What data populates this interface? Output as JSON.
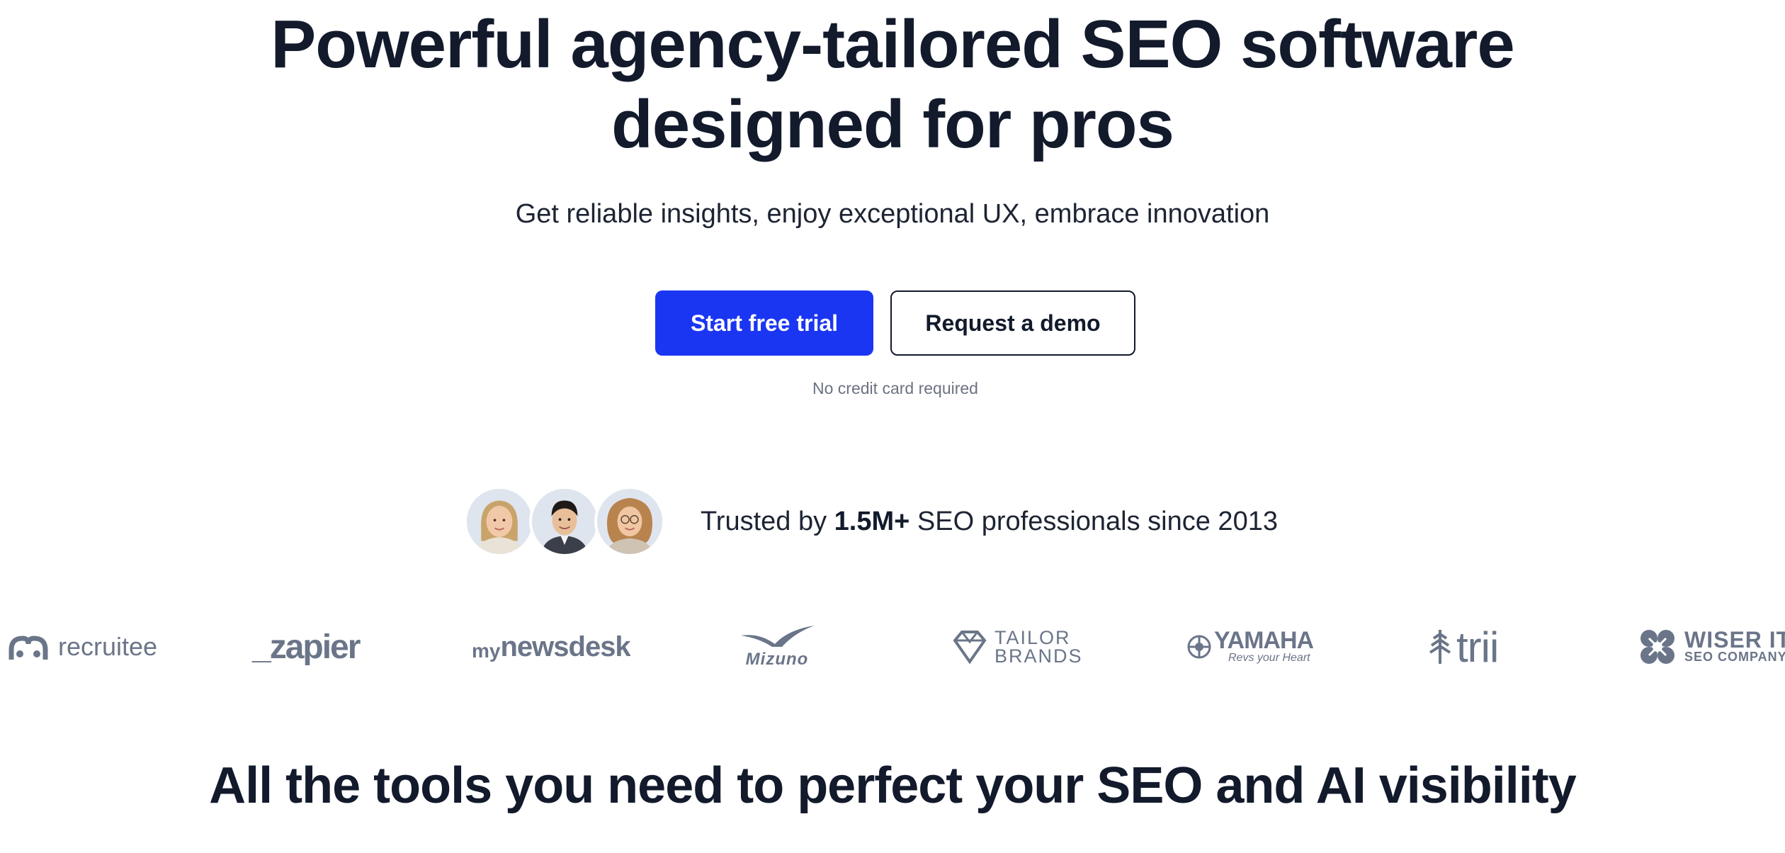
{
  "hero": {
    "title_line1": "Powerful agency-tailored SEO software",
    "title_line2": "designed for pros",
    "subtitle": "Get reliable insights, enjoy exceptional UX, embrace innovation"
  },
  "cta": {
    "primary_label": "Start free trial",
    "secondary_label": "Request a demo",
    "note": "No credit card required"
  },
  "trust": {
    "prefix": "Trusted by ",
    "highlight": "1.5M+",
    "suffix": " SEO professionals since 2013",
    "avatars": [
      "avatar-woman-blonde",
      "avatar-man-dark-hair",
      "avatar-woman-curly"
    ]
  },
  "logos": {
    "recruitee": "recruitee",
    "zapier": "_zapier",
    "mynewsdesk_my": "my",
    "mynewsdesk_main": "newsdesk",
    "mizuno": "Mizuno",
    "tailor_line1": "TAILOR",
    "tailor_line2": "BRANDS",
    "yamaha": "YAMAHA",
    "yamaha_tagline": "Revs your Heart",
    "trii": "trii",
    "wiser_line1": "WISER IT",
    "wiser_line2": "SEO COMPANY"
  },
  "section": {
    "title": "All the tools you need to perfect your SEO and AI visibility"
  },
  "colors": {
    "primary": "#1b36f2",
    "heading": "#121a2c",
    "logo_gray": "#6b7589",
    "note_gray": "#6b7280"
  }
}
